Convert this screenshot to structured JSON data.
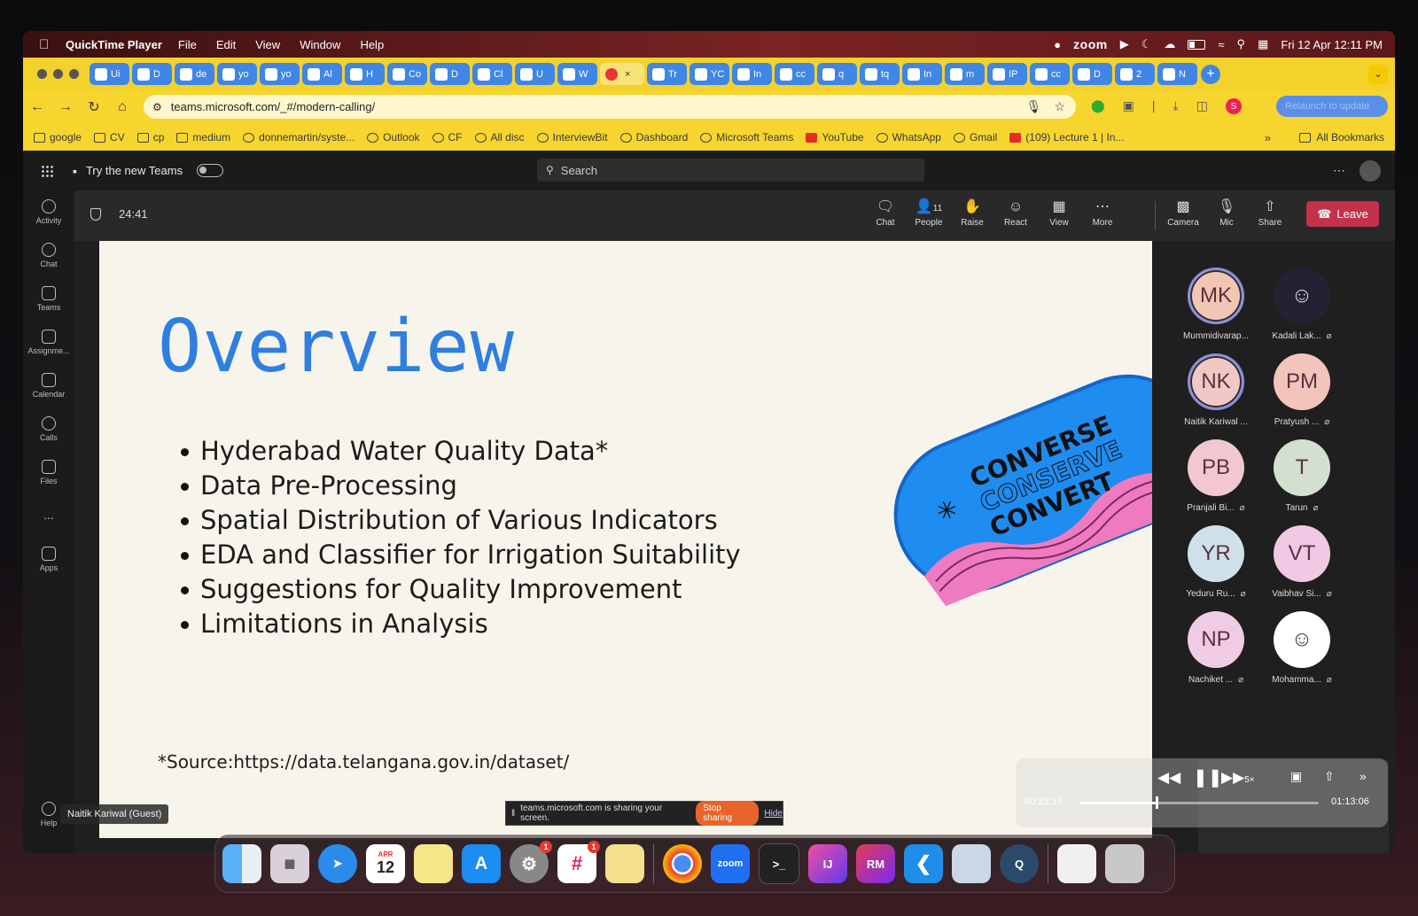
{
  "menubar": {
    "app_name": "QuickTime Player",
    "items": [
      "File",
      "Edit",
      "View",
      "Window",
      "Help"
    ],
    "zoom_label": "zoom",
    "datetime": "Fri 12 Apr  12:11 PM"
  },
  "browser": {
    "tabs": [
      {
        "label": "Ui",
        "icon": "doc-icon"
      },
      {
        "label": "D",
        "icon": "app-icon"
      },
      {
        "label": "de",
        "icon": "github-icon"
      },
      {
        "label": "yo",
        "icon": "github-icon"
      },
      {
        "label": "yo",
        "icon": "github-icon"
      },
      {
        "label": "Al",
        "icon": "pdf-icon"
      },
      {
        "label": "H",
        "icon": "github-icon"
      },
      {
        "label": "Co",
        "icon": "teams-icon"
      },
      {
        "label": "D",
        "icon": "teams-icon"
      },
      {
        "label": "Cl",
        "icon": "chatgpt-icon"
      },
      {
        "label": "U",
        "icon": "github-icon"
      },
      {
        "label": "W",
        "icon": "whatsapp-icon"
      },
      {
        "label": "",
        "icon": "record-icon",
        "active": true
      },
      {
        "label": "Tr",
        "icon": "teams-icon"
      },
      {
        "label": "YC",
        "icon": "app-icon"
      },
      {
        "label": "In",
        "icon": "teams-icon"
      },
      {
        "label": "cc",
        "icon": "app-icon"
      },
      {
        "label": "q",
        "icon": "app-icon"
      },
      {
        "label": "tq",
        "icon": "app-icon"
      },
      {
        "label": "In",
        "icon": "instagram-icon"
      },
      {
        "label": "m",
        "icon": "google-icon"
      },
      {
        "label": "IP",
        "icon": "app-icon"
      },
      {
        "label": "cc",
        "icon": "app-icon"
      },
      {
        "label": "D",
        "icon": "app-icon"
      },
      {
        "label": "2",
        "icon": "app-icon"
      },
      {
        "label": "N",
        "icon": "app-icon"
      }
    ],
    "url": "teams.microsoft.com/_#/modern-calling/",
    "relaunch_label": "Relaunch to update",
    "bookmarks": [
      {
        "label": "google",
        "icon": "folder"
      },
      {
        "label": "CV",
        "icon": "folder"
      },
      {
        "label": "cp",
        "icon": "folder"
      },
      {
        "label": "medium",
        "icon": "folder"
      },
      {
        "label": "donnemartin/syste...",
        "icon": "github"
      },
      {
        "label": "Outlook",
        "icon": "outlook"
      },
      {
        "label": "CF",
        "icon": "codeforces"
      },
      {
        "label": "All disc",
        "icon": "link"
      },
      {
        "label": "InterviewBit",
        "icon": "link"
      },
      {
        "label": "Dashboard",
        "icon": "link"
      },
      {
        "label": "Microsoft Teams",
        "icon": "teams"
      },
      {
        "label": "YouTube",
        "icon": "youtube"
      },
      {
        "label": "WhatsApp",
        "icon": "whatsapp"
      },
      {
        "label": "Gmail",
        "icon": "gmail"
      },
      {
        "label": "(109) Lecture 1 | In...",
        "icon": "youtube"
      }
    ],
    "all_bookmarks": "All Bookmarks",
    "more": "»"
  },
  "teams": {
    "try_new": "Try the new Teams",
    "search_placeholder": "Search",
    "rail": [
      "Activity",
      "Chat",
      "Teams",
      "Assignme...",
      "Calendar",
      "Calls",
      "Files",
      "...",
      "Apps",
      "Help"
    ],
    "timer": "24:41",
    "controls": {
      "chat": "Chat",
      "people": "People",
      "people_count": "11",
      "raise": "Raise",
      "react": "React",
      "view": "View",
      "more": "More",
      "camera": "Camera",
      "mic": "Mic",
      "share": "Share",
      "leave": "Leave"
    },
    "presenter_label": "Naitik Kariwal (Guest)",
    "share_notice": "teams.microsoft.com is sharing your screen.",
    "stop_sharing": "Stop sharing",
    "hide": "Hide",
    "participants": [
      {
        "initials": "MK",
        "name": "Mummidivarap...",
        "muted": false,
        "color": "#f2c6b4",
        "ring": true
      },
      {
        "initials": "",
        "name": "Kadali Lak...",
        "muted": true,
        "color": "#223",
        "photo": true
      },
      {
        "initials": "NK",
        "name": "Naitik Kariwal ...",
        "muted": false,
        "color": "#f1c8c4",
        "ring": true
      },
      {
        "initials": "PM",
        "name": "Pratyush ...",
        "muted": true,
        "color": "#f2c4bc"
      },
      {
        "initials": "PB",
        "name": "Pranjali Bi...",
        "muted": true,
        "color": "#f2c7cf"
      },
      {
        "initials": "T",
        "name": "Tarun",
        "muted": true,
        "color": "#d4e0cf"
      },
      {
        "initials": "YR",
        "name": "Yeduru Ru...",
        "muted": true,
        "color": "#cfe0ea"
      },
      {
        "initials": "VT",
        "name": "Vaibhav Si...",
        "muted": true,
        "color": "#f0c9e4"
      },
      {
        "initials": "NP",
        "name": "Nachiket ...",
        "muted": true,
        "color": "#f0cbe4"
      },
      {
        "initials": "",
        "name": "Mohamma...",
        "muted": true,
        "color": "#fff",
        "photo": true
      }
    ]
  },
  "slide": {
    "title": "Overview",
    "bullets": [
      "Hyderabad Water Quality Data*",
      "Data Pre-Processing",
      "Spatial Distribution of Various Indicators",
      "EDA and Classifier for Irrigation Suitability",
      "Suggestions for Quality Improvement",
      "Limitations in Analysis"
    ],
    "source": "*Source:https://data.telangana.gov.in/dataset/",
    "badge_lines": [
      "CONVERSE",
      "CONSERVE",
      "CONVERT"
    ]
  },
  "player": {
    "elapsed": "00:23:17",
    "total": "01:13:06",
    "progress": 0.32,
    "speed": "5×"
  },
  "dock": {
    "calendar_month": "APR",
    "calendar_day": "12",
    "settings_badge": "1",
    "slack_badge": "1"
  }
}
